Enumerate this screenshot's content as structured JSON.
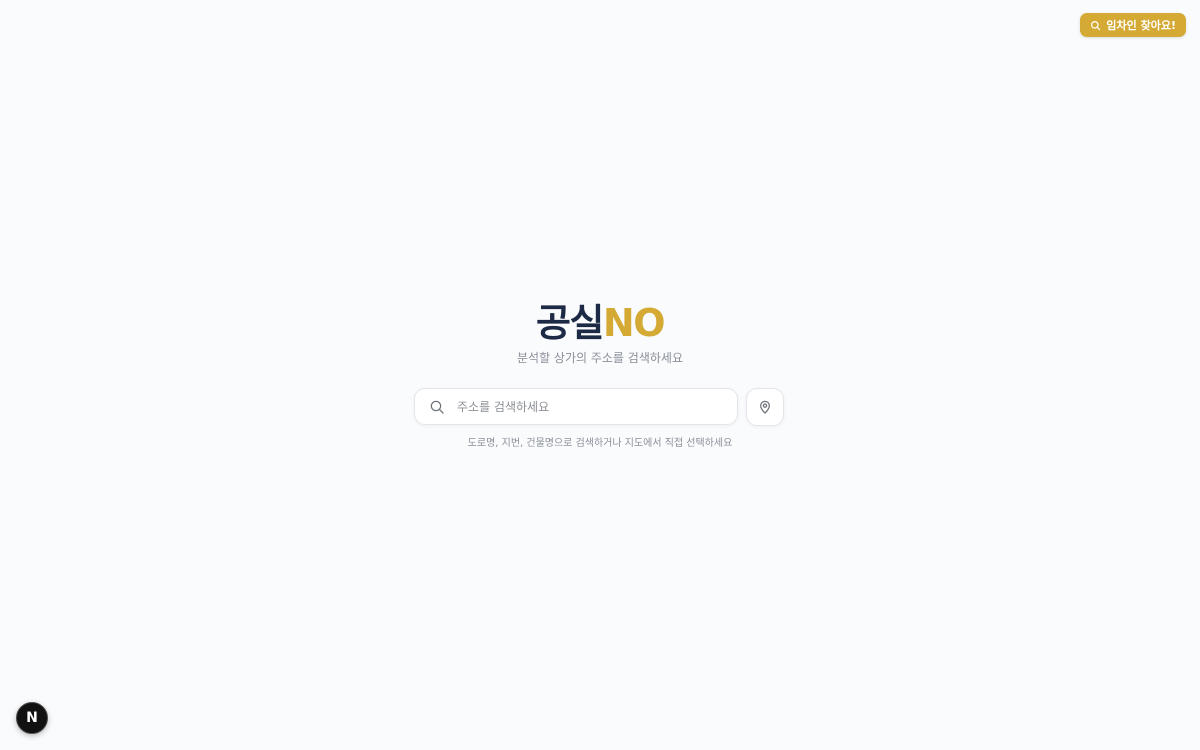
{
  "header": {
    "cta_label": "임차인 찾아요!",
    "cta_icon": "search-icon",
    "cta_color": "#d4aa35"
  },
  "hero": {
    "logo_primary": "공실",
    "logo_accent": "NO",
    "logo_primary_color": "#1d2a45",
    "logo_accent_color": "#d4aa35",
    "subtitle": "분석할 상가의 주소를 검색하세요"
  },
  "search": {
    "placeholder": "주소를 검색하세요",
    "value": "",
    "search_icon": "search-icon",
    "location_icon": "map-pin-icon",
    "hint": "도로명, 지번, 건물명으로 검색하거나 지도에서 직접 선택하세요"
  },
  "devtools": {
    "badge_label": "N"
  }
}
